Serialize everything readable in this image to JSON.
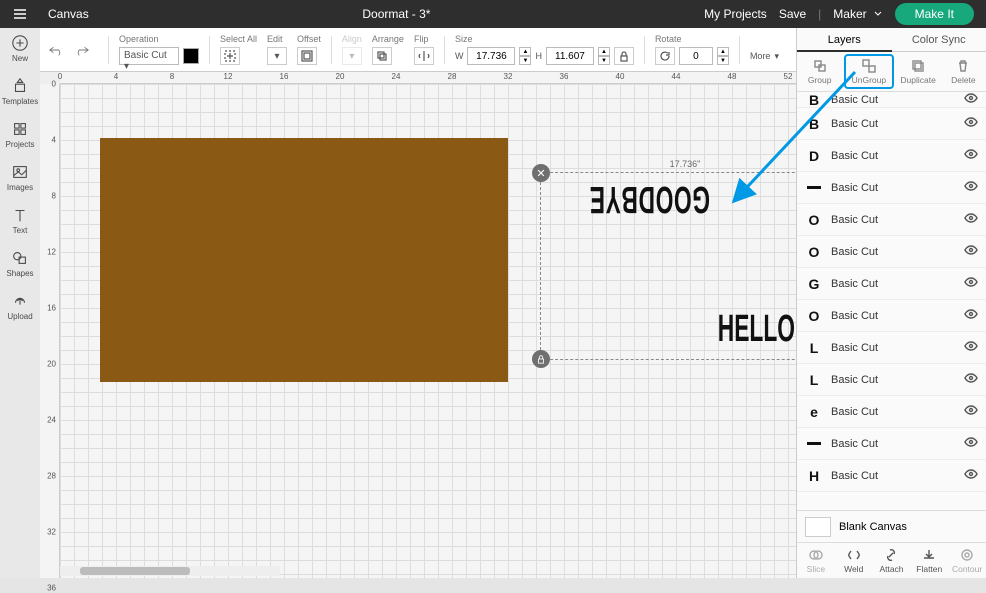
{
  "top": {
    "app_title": "Canvas",
    "project_title": "Doormat - 3*",
    "my_projects": "My Projects",
    "save": "Save",
    "machine": "Maker",
    "make_it": "Make It"
  },
  "left_rail": [
    {
      "label": "New"
    },
    {
      "label": "Templates"
    },
    {
      "label": "Projects"
    },
    {
      "label": "Images"
    },
    {
      "label": "Text"
    },
    {
      "label": "Shapes"
    },
    {
      "label": "Upload"
    }
  ],
  "toolbar": {
    "operation_lbl": "Operation",
    "operation_val": "Basic Cut",
    "select_all_lbl": "Select All",
    "edit_lbl": "Edit",
    "offset_lbl": "Offset",
    "align_lbl": "Align",
    "arrange_lbl": "Arrange",
    "flip_lbl": "Flip",
    "size_lbl": "Size",
    "w_lbl": "W",
    "w_val": "17.736",
    "h_lbl": "H",
    "h_val": "11.607",
    "rotate_lbl": "Rotate",
    "rotate_val": "0",
    "more_lbl": "More"
  },
  "rulers": {
    "h": [
      "0",
      "4",
      "8",
      "12",
      "16",
      "20",
      "24",
      "28",
      "32",
      "36",
      "40",
      "44",
      "48",
      "52"
    ],
    "v": [
      "0",
      "4",
      "8",
      "12",
      "16",
      "20",
      "24",
      "28",
      "32",
      "36"
    ]
  },
  "canvas": {
    "sel_dim": "17.736\"",
    "goodbye": "GOODBYE",
    "hello": "HELLO"
  },
  "right": {
    "tabs": {
      "layers": "Layers",
      "colorsync": "Color Sync"
    },
    "tools": {
      "group": "Group",
      "ungroup": "UnGroup",
      "duplicate": "Duplicate",
      "delete": "Delete"
    },
    "layers": [
      {
        "glyph": "B",
        "label": "Basic Cut",
        "half": true
      },
      {
        "glyph": "B",
        "label": "Basic Cut"
      },
      {
        "glyph": "D",
        "label": "Basic Cut"
      },
      {
        "glyph": "-",
        "label": "Basic Cut"
      },
      {
        "glyph": "O",
        "label": "Basic Cut"
      },
      {
        "glyph": "O",
        "label": "Basic Cut"
      },
      {
        "glyph": "G",
        "label": "Basic Cut"
      },
      {
        "glyph": "O",
        "label": "Basic Cut"
      },
      {
        "glyph": "L",
        "label": "Basic Cut"
      },
      {
        "glyph": "L",
        "label": "Basic Cut"
      },
      {
        "glyph": "e",
        "label": "Basic Cut"
      },
      {
        "glyph": "-",
        "label": "Basic Cut"
      },
      {
        "glyph": "H",
        "label": "Basic Cut"
      }
    ],
    "blank_canvas": "Blank Canvas",
    "ops": {
      "slice": "Slice",
      "weld": "Weld",
      "attach": "Attach",
      "flatten": "Flatten",
      "contour": "Contour"
    }
  }
}
